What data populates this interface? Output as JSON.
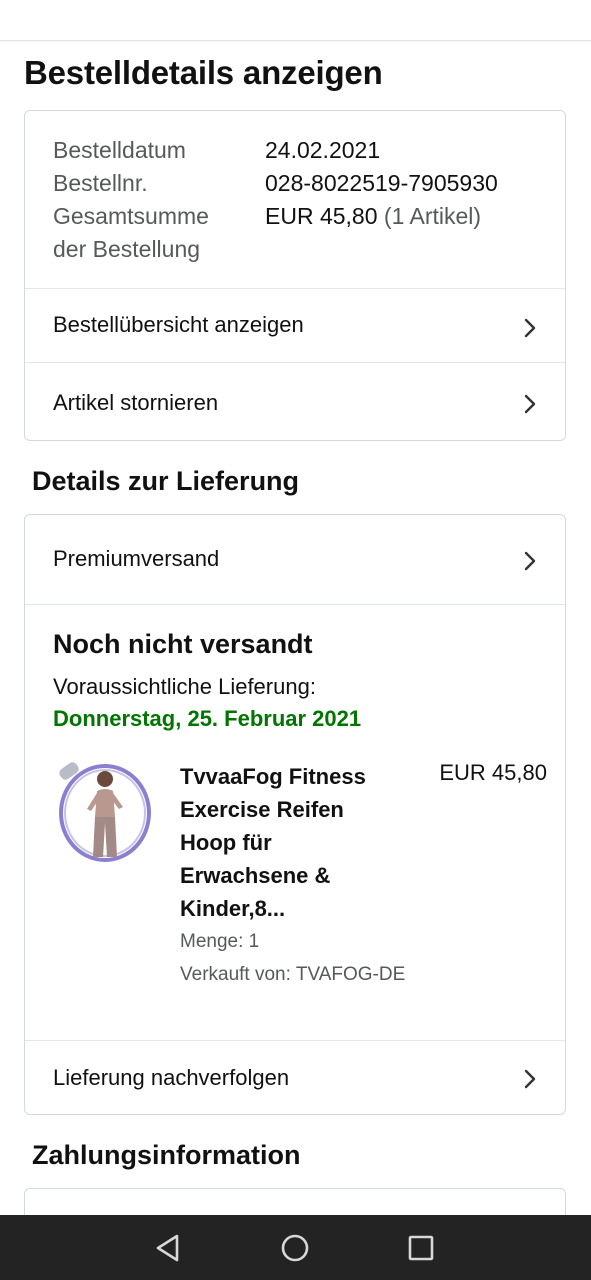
{
  "page": {
    "title": "Bestelldetails anzeigen"
  },
  "order_summary": {
    "order_date_label": "Bestelldatum",
    "order_date_value": "24.02.2021",
    "order_number_label": "Bestellnr.",
    "order_number_value": "028-8022519-7905930",
    "total_label_line1": "Gesamtsumme",
    "total_label_line2": "der Bestellung",
    "total_value": "EUR 45,80",
    "total_items": "(1 Artikel)",
    "view_summary_label": "Bestellübersicht anzeigen",
    "cancel_items_label": "Artikel stornieren"
  },
  "delivery": {
    "section_title": "Details zur Lieferung",
    "shipping_method": "Premiumversand",
    "status": "Noch nicht versandt",
    "eta_label": "Voraussichtliche Lieferung:",
    "eta_date": "Donnerstag, 25. Februar 2021",
    "eta_color": "#007600",
    "item": {
      "title_lines": [
        "TvvaaFog Fitness",
        "Exercise Reifen",
        "Hoop für",
        "Erwachsene &",
        "Kinder,8..."
      ],
      "price": "EUR 45,80",
      "quantity": "Menge: 1",
      "seller": "Verkauft von: TVAFOG-DE",
      "image_icon": "product-image"
    },
    "track_label": "Lieferung nachverfolgen"
  },
  "payment": {
    "section_title": "Zahlungsinformation"
  },
  "system_nav": {
    "back_icon": "back-triangle-icon",
    "home_icon": "home-circle-icon",
    "recents_icon": "recents-square-icon"
  },
  "colors": {
    "border": "#d5d9d9",
    "muted_text": "#565959",
    "nav_bar": "#232323"
  }
}
